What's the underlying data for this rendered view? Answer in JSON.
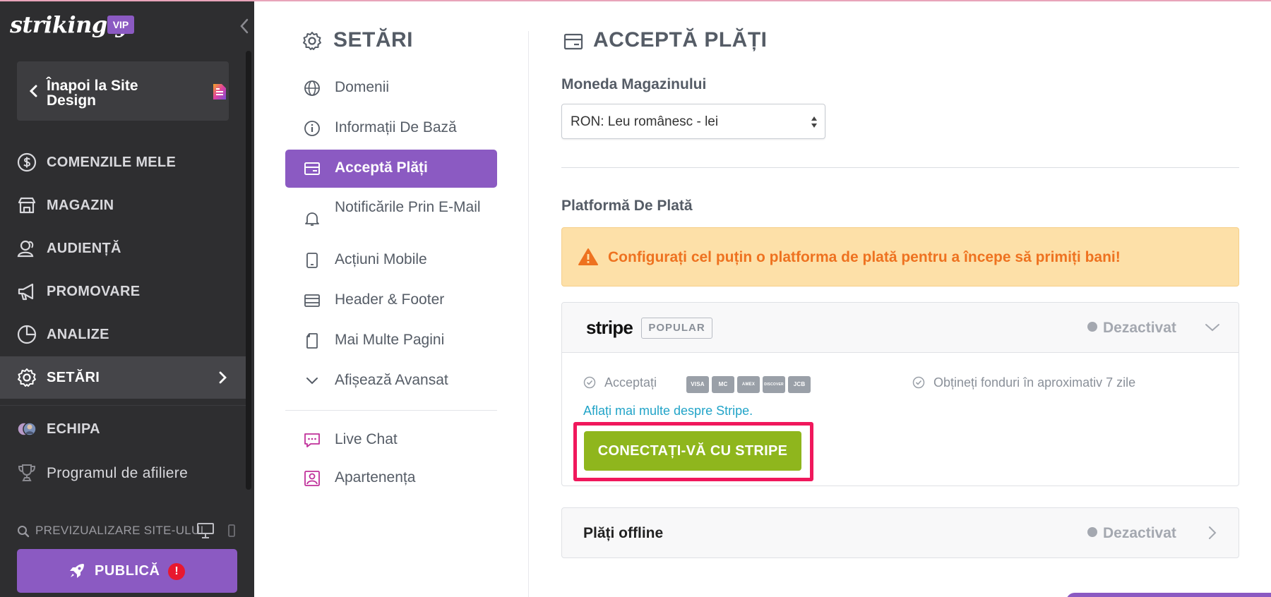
{
  "brand": {
    "logo": "strikingly",
    "badge": "VIP"
  },
  "sidebar": {
    "back_label": "Înapoi la Site Design",
    "items": [
      {
        "label": "COMENZILE MELE",
        "icon": "dollar-circle-icon"
      },
      {
        "label": "MAGAZIN",
        "icon": "store-icon"
      },
      {
        "label": "AUDIENȚĂ",
        "icon": "audience-icon"
      },
      {
        "label": "PROMOVARE",
        "icon": "megaphone-icon"
      },
      {
        "label": "ANALIZE",
        "icon": "pie-chart-icon"
      },
      {
        "label": "SETĂRI",
        "icon": "gear-icon",
        "active": true
      },
      {
        "label": "ECHIPA",
        "icon": "team-avatars-icon"
      },
      {
        "label": "Programul de afiliere",
        "icon": "trophy-icon"
      }
    ],
    "preview_label": "PREVIZUALIZARE SITE-ULUI",
    "publish_label": "PUBLICĂ",
    "publish_alert": "!"
  },
  "settings_menu": {
    "title": "SETĂRI",
    "items": [
      {
        "label": "Domenii",
        "icon": "globe-icon"
      },
      {
        "label": "Informații De Bază",
        "icon": "info-icon"
      },
      {
        "label": "Acceptă Plăți",
        "icon": "wallet-icon",
        "active": true
      },
      {
        "label": "Notificările Prin E-Mail",
        "icon": "bell-icon"
      },
      {
        "label": "Acțiuni Mobile",
        "icon": "mobile-icon"
      },
      {
        "label": "Header & Footer",
        "icon": "layout-icon"
      },
      {
        "label": "Mai Multe Pagini",
        "icon": "pages-icon"
      },
      {
        "label": "Afișează Avansat",
        "icon": "chevron-down-icon"
      },
      {
        "label": "Live Chat",
        "icon": "chat-icon"
      },
      {
        "label": "Apartenența",
        "icon": "member-icon"
      }
    ]
  },
  "main": {
    "title": "ACCEPTĂ PLĂȚI",
    "currency_label": "Moneda Magazinului",
    "currency_value": "RON: Leu românesc - lei",
    "platform_label": "Platformă De Plată",
    "warning": "Configurați cel puțin o platforma de plată pentru a începe să primiți bani!",
    "stripe": {
      "name": "stripe",
      "badge": "POPULAR",
      "status": "Dezactivat",
      "accept_label": "Acceptați",
      "cards": [
        "VISA",
        "MC",
        "AMEX",
        "DISCOVER",
        "JCB"
      ],
      "funds_text": "Obțineți fonduri în aproximativ 7 zile",
      "learn_more": "Aflați mai multe despre Stripe.",
      "connect_button": "CONECTAȚI-VĂ CU STRIPE"
    },
    "offline": {
      "title": "Plăți offline",
      "status": "Dezactivat"
    }
  },
  "colors": {
    "sidebar_bg": "#2e2e30",
    "accent_purple": "#8b5ac2",
    "warning_bg": "#fde0a8",
    "warning_text": "#ee7220",
    "connect_green": "#8fb61d",
    "highlight_pink": "#f0185c",
    "link_blue": "#22a4c8"
  }
}
